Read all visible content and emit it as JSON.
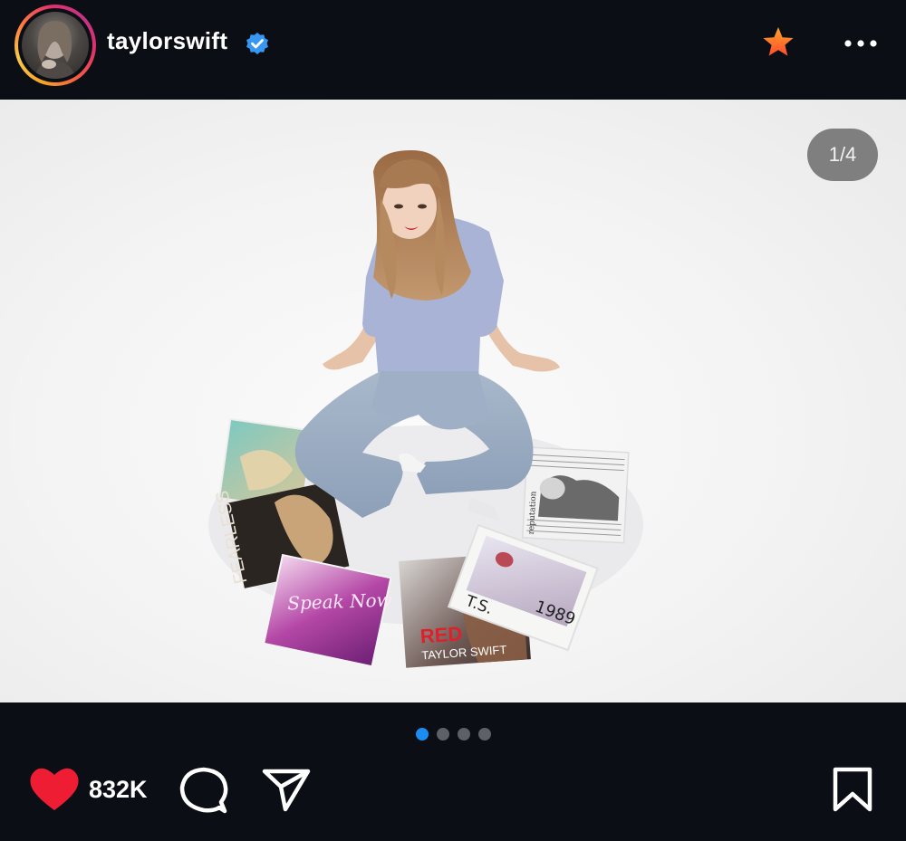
{
  "header": {
    "username": "taylorswift",
    "verified": true,
    "star_icon": "star-icon",
    "more_icon": "more-horizontal-icon"
  },
  "post": {
    "image_counter": "1/4",
    "pages_total": 4,
    "page_current": 1,
    "album_labels": {
      "fearless": "FEARLESS",
      "speak_now": "Speak Now",
      "red_title": "RED",
      "red_artist": "TAYLOR SWIFT",
      "nineteen_89": "1989",
      "ts": "T.S.",
      "reputation": "reputation"
    }
  },
  "actions": {
    "like_count": "832K",
    "liked": true
  },
  "colors": {
    "background": "#0b0e15",
    "accent_blue": "#1c8cf0",
    "like_red": "#ee1d33",
    "star_orange": "#ff6a2b"
  }
}
